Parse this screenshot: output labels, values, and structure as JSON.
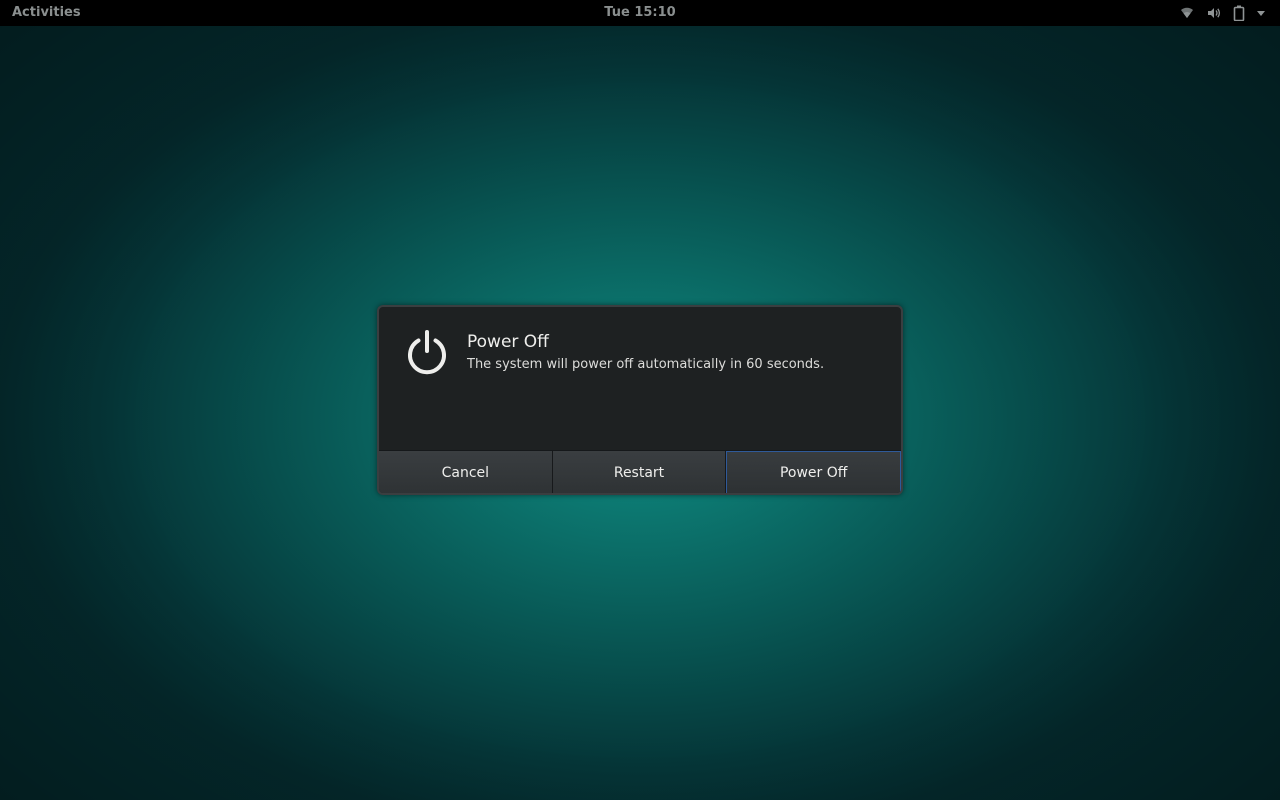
{
  "topbar": {
    "activities_label": "Activities",
    "clock": "Tue 15:10",
    "status_icons": [
      "wifi-icon",
      "volume-icon",
      "battery-icon",
      "chevron-down-icon"
    ]
  },
  "dialog": {
    "icon": "power-icon",
    "title": "Power Off",
    "message": "The system will power off automatically in 60 seconds.",
    "buttons": {
      "cancel": "Cancel",
      "restart": "Restart",
      "power_off": "Power Off"
    },
    "default_button": "power_off"
  },
  "colors": {
    "background_center": "#0f8e84",
    "background_edge": "#042a2d",
    "dialog_bg": "#1e2122",
    "default_button_border": "#2f5a9a"
  }
}
